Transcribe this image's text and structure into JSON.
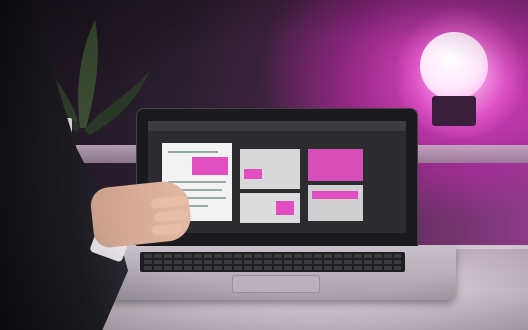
{
  "scene": {
    "description_colors": {
      "accent": "#e14ebf",
      "background_dark": "#2a1c2b"
    }
  },
  "screen": {
    "topbar_text": ""
  }
}
